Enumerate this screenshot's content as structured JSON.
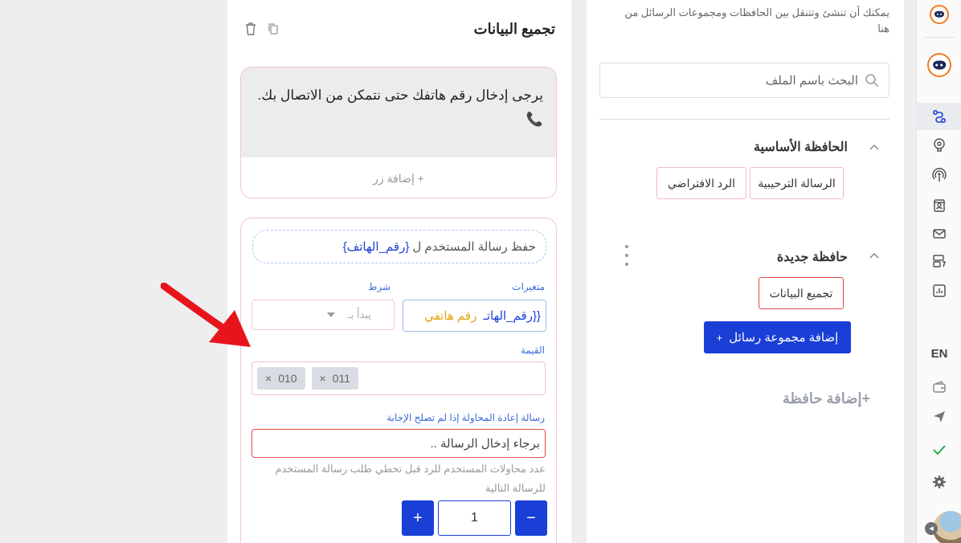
{
  "sidebar": {
    "lang": "EN",
    "icons": [
      "logo-icon",
      "logo-active-icon",
      "flow-icon",
      "brain-icon",
      "broadcast-icon",
      "contacts-icon",
      "mail-icon",
      "templates-icon",
      "analytics-icon",
      "wallet-icon",
      "send-icon",
      "check-icon",
      "gear-icon"
    ]
  },
  "folders": {
    "hint": "يمكنك أن تنشئ وتتنقل بين الحافظات ومجموعات الرسائل من هنا",
    "search_placeholder": "البحث باسم الملف",
    "main_folder": {
      "title": "الحافظة الأساسية",
      "items": [
        "الرسالة الترحيبية",
        "الرد الافتراضي"
      ]
    },
    "new_folder": {
      "title": "حافظة جديدة",
      "items": [
        "تجميع البيانات"
      ]
    },
    "add_group_label": "إضافة مجموعة رسائل",
    "add_group_plus": "+",
    "add_folder_label": "+إضافة حافظة"
  },
  "editor": {
    "title": "تجميع البيانات",
    "message_text": "يرجى إدخال رقم هاتفك حتى نتمكن من الاتصال بك. 📞",
    "add_button_label": "+ إضافة زر",
    "save_prefix": "حفظ رسالة المستخدم ل",
    "save_variable": "{رقم_الهاتف}",
    "variables_label": "متغيرات",
    "condition_label": "شرط",
    "variable_value": "{{رقم_الهاتـ",
    "variable_name": "رقم هاتفي",
    "condition_value": "يبدأ بـ",
    "value_label": "القيمة",
    "value_tags": [
      "010",
      "011"
    ],
    "retry_label": "رسالة إعادة المحاولة إذا لم تصلح الإجابة",
    "retry_value": "برجاء إدخال الرسالة ..",
    "attempts_note": "عدد محاولات المستخدم للرد قبل تخطي طلب رسالة المستخدم للرسالة التالية",
    "attempts_value": "1",
    "minus": "−",
    "plus": "+"
  },
  "colors": {
    "brand_blue": "#1a3fd6",
    "accent_orange": "#f47a20",
    "error_red": "#e04b4b",
    "annotation_red": "#e8141b"
  }
}
